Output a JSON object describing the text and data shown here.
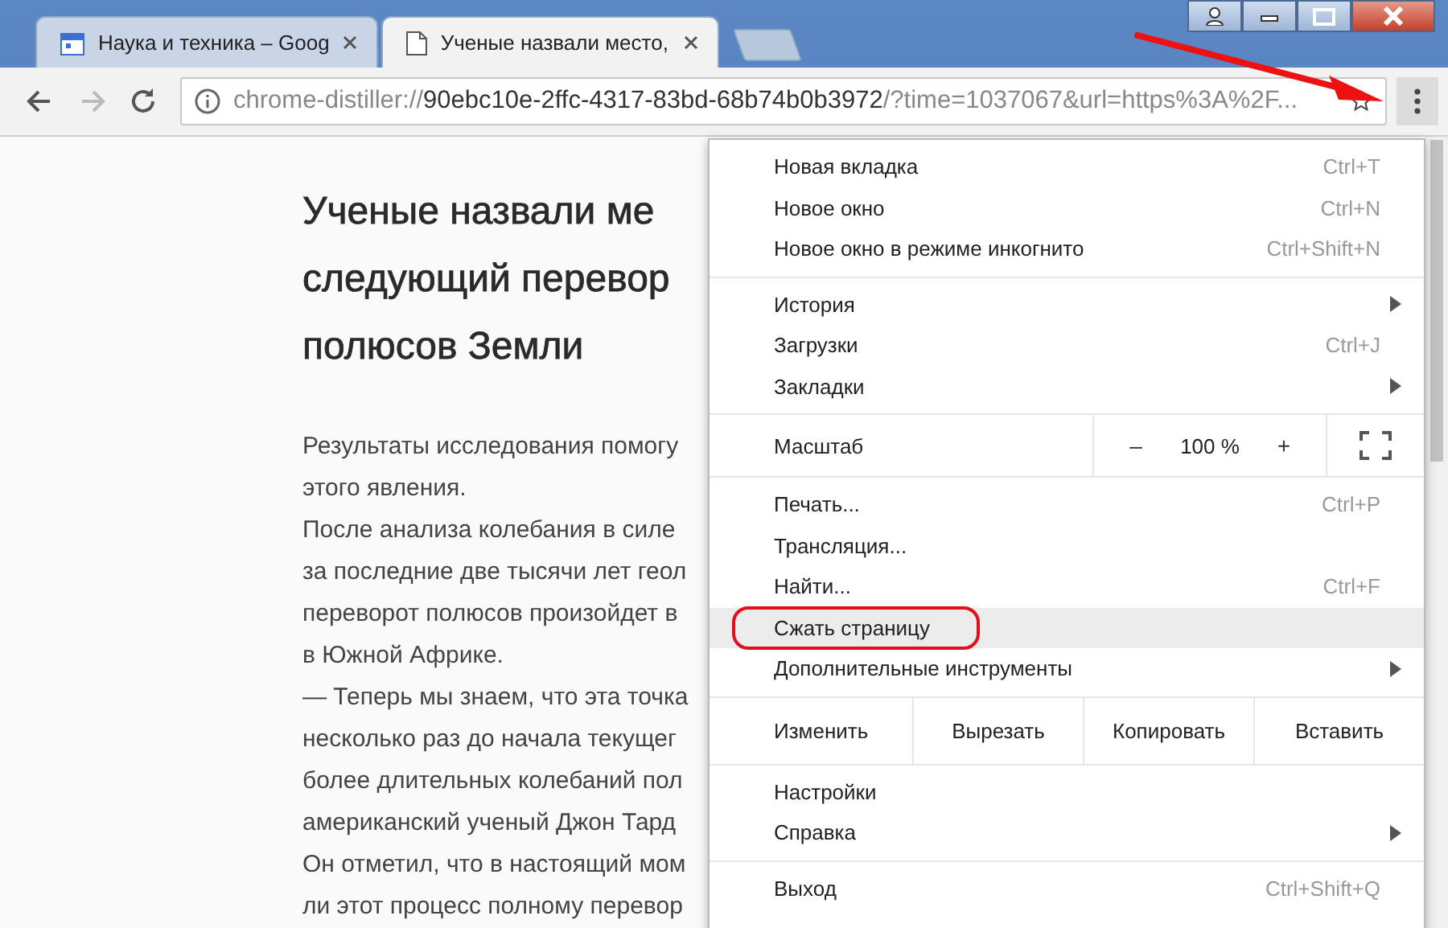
{
  "tabs": [
    {
      "title": "Наука и техника – Goog",
      "selected": false
    },
    {
      "title": "Ученые назвали место, ",
      "selected": true
    }
  ],
  "address": {
    "scheme": "chrome-distiller://",
    "host": "90ebc10e-2ffc-4317-83bd-68b74b0b3972",
    "rest": "/?time=1037067&url=https%3A%2F..."
  },
  "article": {
    "title_lines": [
      "Ученые назвали ме",
      "следующий перевор",
      "полюсов Земли"
    ],
    "lines": [
      "Результаты исследования помогу",
      "этого явления.",
      "После анализа колебания в силе",
      "за последние две тысячи лет геол",
      "переворот полюсов произойдет в",
      "в Южной Африке.",
      "— Теперь мы знаем, что эта точка",
      "несколько раз до начала текущег",
      "более длительных колебаний пол",
      "американский ученый Джон Тард",
      "Он отметил, что в настоящий мом",
      "ли этот процесс полному перевор"
    ]
  },
  "menu": {
    "sections": [
      {
        "kind": "items",
        "items": [
          {
            "label": "Новая вкладка",
            "shortcut": "Ctrl+T",
            "submenu": false,
            "selected": false
          },
          {
            "label": "Новое окно",
            "shortcut": "Ctrl+N",
            "submenu": false,
            "selected": false
          },
          {
            "label": "Новое окно в режиме инкогнито",
            "shortcut": "Ctrl+Shift+N",
            "submenu": false,
            "selected": false
          }
        ]
      },
      {
        "kind": "items",
        "items": [
          {
            "label": "История",
            "submenu": true,
            "selected": false
          },
          {
            "label": "Загрузки",
            "shortcut": "Ctrl+J",
            "submenu": false,
            "selected": false
          },
          {
            "label": "Закладки",
            "submenu": true,
            "selected": false
          }
        ]
      },
      {
        "kind": "zoom",
        "label": "Масштаб",
        "minus": "–",
        "value": "100 %",
        "plus": "+"
      },
      {
        "kind": "items",
        "items": [
          {
            "label": "Печать...",
            "shortcut": "Ctrl+P",
            "submenu": false,
            "selected": false
          },
          {
            "label": "Трансляция...",
            "submenu": false,
            "selected": false
          },
          {
            "label": "Найти...",
            "shortcut": "Ctrl+F",
            "submenu": false,
            "selected": false
          },
          {
            "label": "Сжать страницу",
            "submenu": false,
            "selected": true
          },
          {
            "label": "Дополнительные инструменты",
            "submenu": true,
            "selected": false
          }
        ]
      },
      {
        "kind": "edit",
        "label": "Изменить",
        "buttons": [
          "Вырезать",
          "Копировать",
          "Вставить"
        ]
      },
      {
        "kind": "items",
        "items": [
          {
            "label": "Настройки",
            "submenu": false,
            "selected": false
          },
          {
            "label": "Справка",
            "submenu": true,
            "selected": false
          }
        ]
      },
      {
        "kind": "items",
        "items": [
          {
            "label": "Выход",
            "shortcut": "Ctrl+Shift+Q",
            "submenu": false,
            "selected": false
          }
        ]
      }
    ]
  }
}
